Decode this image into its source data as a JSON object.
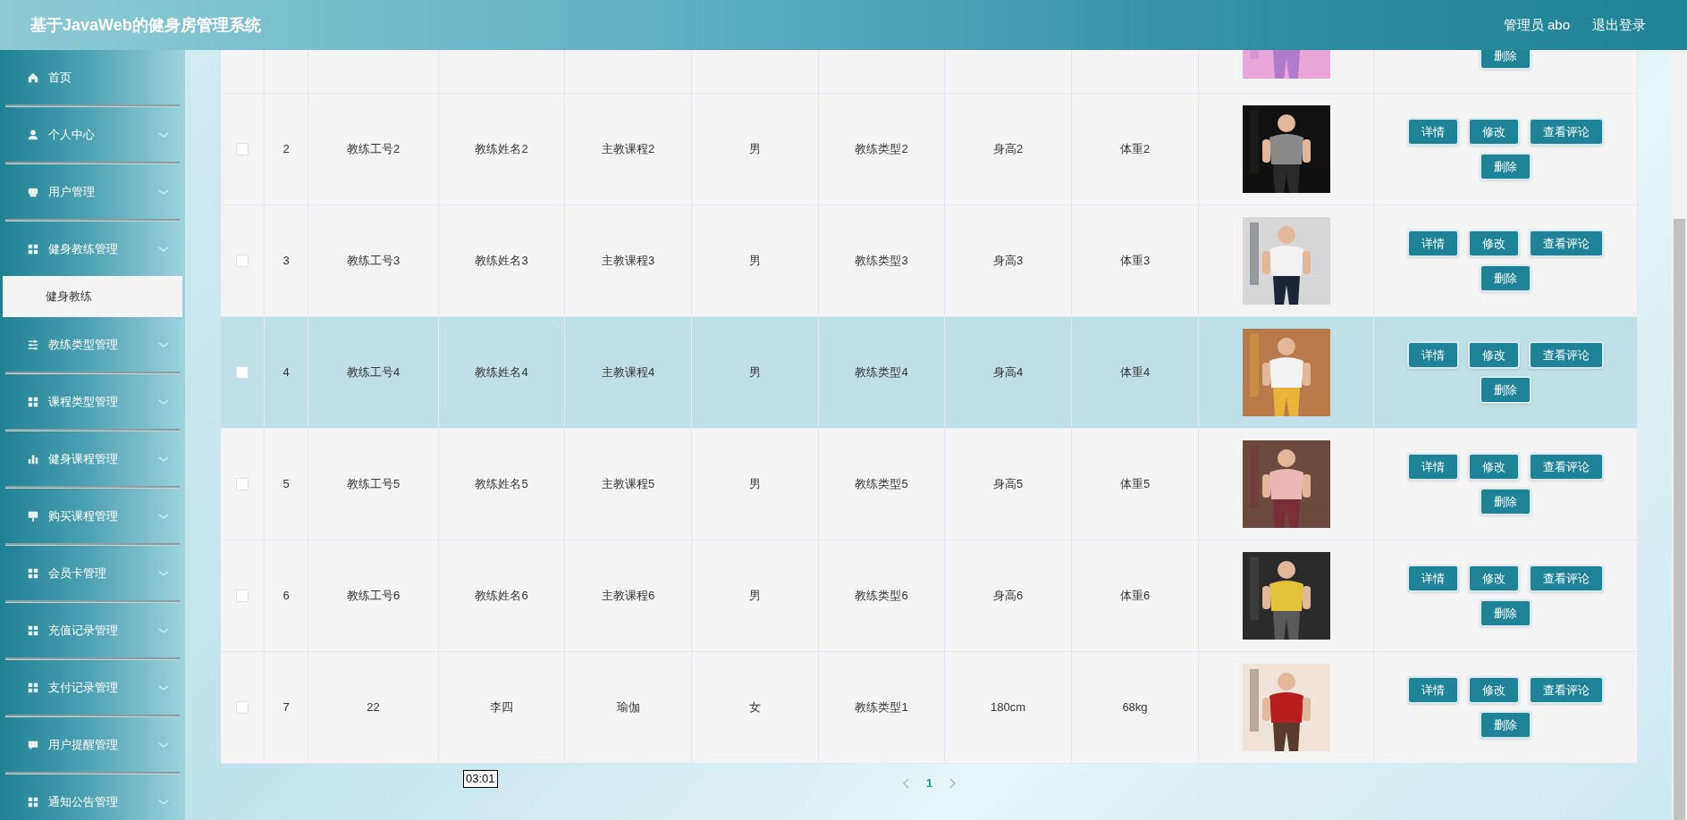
{
  "header": {
    "title": "基于JavaWeb的健身房管理系统",
    "user": "管理员 abo",
    "logout": "退出登录"
  },
  "sidebar": {
    "items": [
      {
        "label": "首页",
        "expandable": false
      },
      {
        "label": "个人中心",
        "expandable": true
      },
      {
        "label": "用户管理",
        "expandable": true
      },
      {
        "label": "健身教练管理",
        "expandable": true,
        "expanded": true,
        "children": [
          {
            "label": "健身教练",
            "selected": true
          }
        ]
      },
      {
        "label": "教练类型管理",
        "expandable": true
      },
      {
        "label": "课程类型管理",
        "expandable": true
      },
      {
        "label": "健身课程管理",
        "expandable": true
      },
      {
        "label": "购买课程管理",
        "expandable": true
      },
      {
        "label": "会员卡管理",
        "expandable": true
      },
      {
        "label": "充值记录管理",
        "expandable": true
      },
      {
        "label": "支付记录管理",
        "expandable": true
      },
      {
        "label": "用户提醒管理",
        "expandable": true
      },
      {
        "label": "通知公告管理",
        "expandable": true
      }
    ]
  },
  "table": {
    "cut_row": {
      "actions": [
        "删除"
      ]
    },
    "rows": [
      {
        "checked": false,
        "highlighted": false,
        "cells": [
          "2",
          "教练工号2",
          "教练姓名2",
          "主教课程2",
          "男",
          "教练类型2",
          "身高2",
          "体重2"
        ],
        "actions": [
          "详情",
          "修改",
          "查看评论",
          "删除"
        ]
      },
      {
        "checked": false,
        "highlighted": false,
        "cells": [
          "3",
          "教练工号3",
          "教练姓名3",
          "主教课程3",
          "男",
          "教练类型3",
          "身高3",
          "体重3"
        ],
        "actions": [
          "详情",
          "修改",
          "查看评论",
          "删除"
        ]
      },
      {
        "checked": false,
        "highlighted": true,
        "cells": [
          "4",
          "教练工号4",
          "教练姓名4",
          "主教课程4",
          "男",
          "教练类型4",
          "身高4",
          "体重4"
        ],
        "actions": [
          "详情",
          "修改",
          "查看评论",
          "删除"
        ]
      },
      {
        "checked": false,
        "highlighted": false,
        "cells": [
          "5",
          "教练工号5",
          "教练姓名5",
          "主教课程5",
          "男",
          "教练类型5",
          "身高5",
          "体重5"
        ],
        "actions": [
          "详情",
          "修改",
          "查看评论",
          "删除"
        ]
      },
      {
        "checked": false,
        "highlighted": false,
        "cells": [
          "6",
          "教练工号6",
          "教练姓名6",
          "主教课程6",
          "男",
          "教练类型6",
          "身高6",
          "体重6"
        ],
        "actions": [
          "详情",
          "修改",
          "查看评论",
          "删除"
        ]
      },
      {
        "checked": false,
        "highlighted": false,
        "cells": [
          "7",
          "22",
          "李四",
          "瑜伽",
          "女",
          "教练类型1",
          "180cm",
          "68kg"
        ],
        "actions": [
          "详情",
          "修改",
          "查看评论",
          "删除"
        ]
      }
    ]
  },
  "pagination": {
    "pages": [
      {
        "label": "1",
        "selected": true
      }
    ]
  },
  "tooltip": "03:01"
}
